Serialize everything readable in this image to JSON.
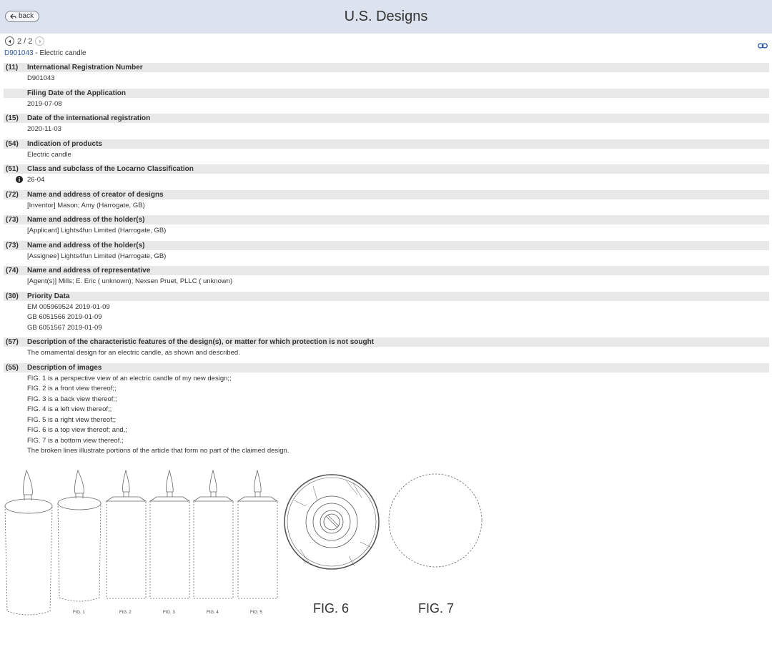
{
  "header": {
    "back_label": "back",
    "title": "U.S. Designs"
  },
  "pager": {
    "text": "2 / 2"
  },
  "design": {
    "number": "D901043",
    "separator": " - Electric candle"
  },
  "records": [
    {
      "code": "(11)",
      "label": "International Registration Number",
      "values": [
        "D901043"
      ]
    },
    {
      "code": "",
      "label": "Filing Date of the Application",
      "values": [
        "2019-07-08"
      ]
    },
    {
      "code": "(15)",
      "label": "Date of the international registration",
      "values": [
        "2020-11-03"
      ]
    },
    {
      "code": "(54)",
      "label": "Indication of products",
      "values": [
        "Electric candle"
      ]
    },
    {
      "code": "(51)",
      "label": "Class and subclass of the Locarno Classification",
      "values": [
        "26-04"
      ]
    },
    {
      "code": "(72)",
      "label": "Name and address of creator of designs",
      "values": [
        "[Inventor] Mason; Amy (Harrogate, GB)"
      ]
    },
    {
      "code": "(73)",
      "label": "Name and address of the holder(s)",
      "values": [
        "[Applicant]  Lights4fun Limited (Harrogate, GB)"
      ]
    },
    {
      "code": "(73)",
      "label": "Name and address of the holder(s)",
      "values": [
        "[Assignee]  Lights4fun Limited (Harrogate, GB)"
      ]
    },
    {
      "code": "(74)",
      "label": "Name and address of representative",
      "values": [
        "[Agent(s)] Mills; E. Eric ( unknown); Nexsen Pruet, PLLC ( unknown)"
      ]
    },
    {
      "code": "(30)",
      "label": "Priority Data",
      "values": [
        "EM 005969524 2019-01-09",
        "GB 6051566 2019-01-09",
        "GB 6051567 2019-01-09"
      ]
    },
    {
      "code": "(57)",
      "label": "Description of the characteristic features of the design(s), or matter for which protection is not sought",
      "values": [
        "The ornamental design for an electric candle, as shown and described."
      ]
    },
    {
      "code": "(55)",
      "label": "Description of images",
      "values": [
        "FIG. 1 is a perspective view of an electric candle of my new design;;",
        "FIG. 2 is a front view thereof;;",
        "FIG. 3 is a back view thereof;;",
        "FIG. 4 is a left view thereof;;",
        "FIG. 5 is a right view thereof;;",
        "FIG. 6 is a top view thereof; and,;",
        "FIG. 7 is a bottom view thereof.;",
        "The broken lines illustrate portions of the article that form no part of the claimed design."
      ]
    }
  ],
  "figures": {
    "fig1": "FIG. 1",
    "fig2": "FIG. 2",
    "fig3": "FIG. 3",
    "fig4": "FIG. 4",
    "fig5": "FIG. 5",
    "fig6": "FIG. 6",
    "fig7": "FIG. 7"
  },
  "icons": {
    "back": "back-arrow-icon",
    "prev": "chevron-left-icon",
    "next": "chevron-right-icon",
    "link": "link-icon",
    "info": "info-icon"
  },
  "colors": {
    "header_bg": "#dde3ee",
    "link": "#2c5aa0",
    "row_bg": "#e8e8e8"
  }
}
